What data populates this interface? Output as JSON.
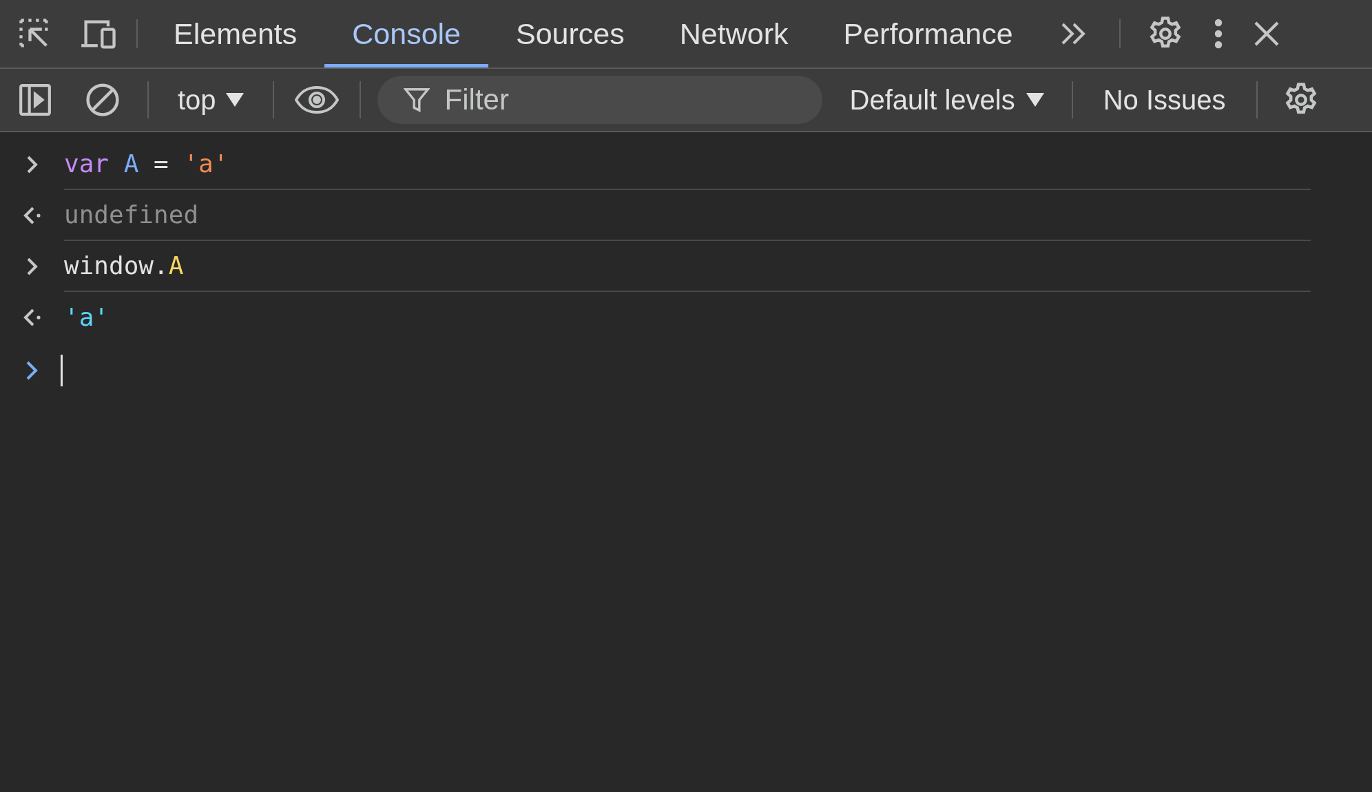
{
  "tabs": [
    {
      "label": "Elements",
      "selected": false
    },
    {
      "label": "Console",
      "selected": true
    },
    {
      "label": "Sources",
      "selected": false
    },
    {
      "label": "Network",
      "selected": false
    },
    {
      "label": "Performance",
      "selected": false
    }
  ],
  "console_toolbar": {
    "context": "top",
    "filter": {
      "placeholder": "Filter"
    },
    "levels": "Default levels",
    "issues": "No Issues"
  },
  "entries": [
    {
      "kind": "input",
      "tokens": [
        {
          "text": "var ",
          "color": "#c58af9"
        },
        {
          "text": "A",
          "color": "#7cacf8"
        },
        {
          "text": " = ",
          "color": "#e3e3e3"
        },
        {
          "text": "'a'",
          "color": "#f28b54"
        }
      ]
    },
    {
      "kind": "output",
      "tokens": [
        {
          "text": "undefined",
          "color": "#8e918f"
        }
      ]
    },
    {
      "kind": "input",
      "tokens": [
        {
          "text": "window.",
          "color": "#e3e3e3"
        },
        {
          "text": "A",
          "color": "#fdd663"
        }
      ]
    },
    {
      "kind": "output",
      "tokens": [
        {
          "text": "'a'",
          "color": "#5cd5fb"
        }
      ]
    }
  ]
}
